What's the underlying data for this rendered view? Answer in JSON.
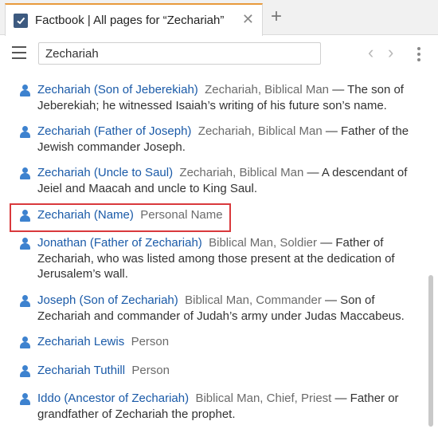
{
  "tab": {
    "title": "Factbook | All pages for “Zechariah”",
    "close_glyph": "✕",
    "icon": "checkbox-icon"
  },
  "new_tab_glyph": "+",
  "toolbar": {
    "menu_icon": "hamburger-menu-icon",
    "search_value": "Zechariah",
    "back_glyph": "‹",
    "forward_glyph": "›",
    "more_icon": "vertical-dots-icon"
  },
  "results": [
    {
      "title": "Zechariah (Son of Jeberekiah)",
      "category": "Zechariah, Biblical Man",
      "desc": " — The son of Jeberekiah; he witnessed Isaiah’s writing of his future son’s name.",
      "icon": "person-icon"
    },
    {
      "title": "Zechariah (Father of Joseph)",
      "category": "Zechariah, Biblical Man",
      "desc": " — Father of the Jewish commander Joseph.",
      "icon": "person-icon"
    },
    {
      "title": "Zechariah (Uncle to Saul)",
      "category": "Zechariah, Biblical Man",
      "desc": " — A descendant of Jeiel and Maacah and uncle to King Saul.",
      "icon": "person-icon"
    },
    {
      "title": "Zechariah (Name)",
      "category": "Personal Name",
      "desc": "",
      "icon": "person-icon",
      "highlighted": true
    },
    {
      "title": "Jonathan (Father of Zechariah)",
      "category": "Biblical Man, Soldier",
      "desc": " — Father of Zechariah, who was listed among those present at the dedication of Jerusalem’s wall.",
      "icon": "person-icon"
    },
    {
      "title": "Joseph (Son of Zechariah)",
      "category": "Biblical Man, Commander",
      "desc": " — Son of Zechariah and commander of Judah’s army under Judas Maccabeus.",
      "icon": "person-icon"
    },
    {
      "title": "Zechariah Lewis",
      "category": "Person",
      "desc": "",
      "icon": "person-icon"
    },
    {
      "title": "Zechariah Tuthill",
      "category": "Person",
      "desc": "",
      "icon": "person-icon"
    },
    {
      "title": "Iddo (Ancestor of Zechariah)",
      "category": "Biblical Man, Chief, Priest",
      "desc": " — Father or grandfather of Zechariah the prophet.",
      "icon": "person-icon"
    }
  ],
  "colors": {
    "accent": "#e89a3c",
    "link": "#1a5aa8",
    "icon": "#3d82cf",
    "highlight_border": "#d9393c"
  }
}
